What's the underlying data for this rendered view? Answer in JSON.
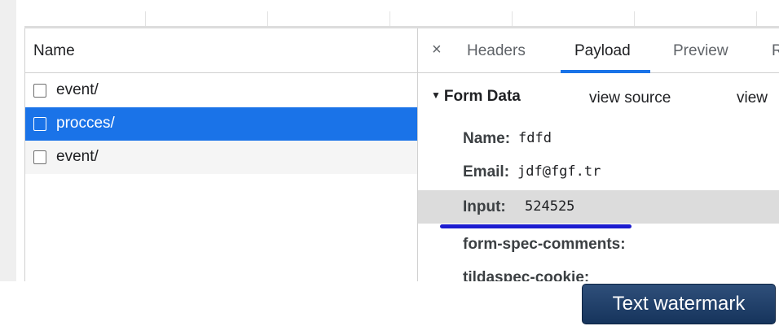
{
  "network_list": {
    "header": "Name",
    "rows": [
      {
        "label": "event/",
        "selected": false
      },
      {
        "label": "procces/",
        "selected": true
      },
      {
        "label": "event/",
        "selected": false
      }
    ]
  },
  "detail": {
    "close_glyph": "×",
    "tabs": [
      {
        "label": "Headers",
        "active": false
      },
      {
        "label": "Payload",
        "active": true
      },
      {
        "label": "Preview",
        "active": false
      },
      {
        "label": "R",
        "active": false
      }
    ],
    "section": {
      "toggle_glyph": "▼",
      "title": "Form Data",
      "view_source": "view source",
      "view_other": "view"
    },
    "fields": [
      {
        "key": "Name:",
        "value": "fdfd"
      },
      {
        "key": "Email:",
        "value": "jdf@fgf.tr"
      },
      {
        "key": "Input:",
        "value": "524525"
      },
      {
        "key": "form-spec-comments:",
        "value": ""
      },
      {
        "key": "tildaspec-cookie:",
        "value": ""
      }
    ]
  },
  "watermark": "Text watermark",
  "colors": {
    "accent": "#1a73e8",
    "highlight_row": "#dcdcdc",
    "annotation_underline": "#1c1ccf"
  }
}
